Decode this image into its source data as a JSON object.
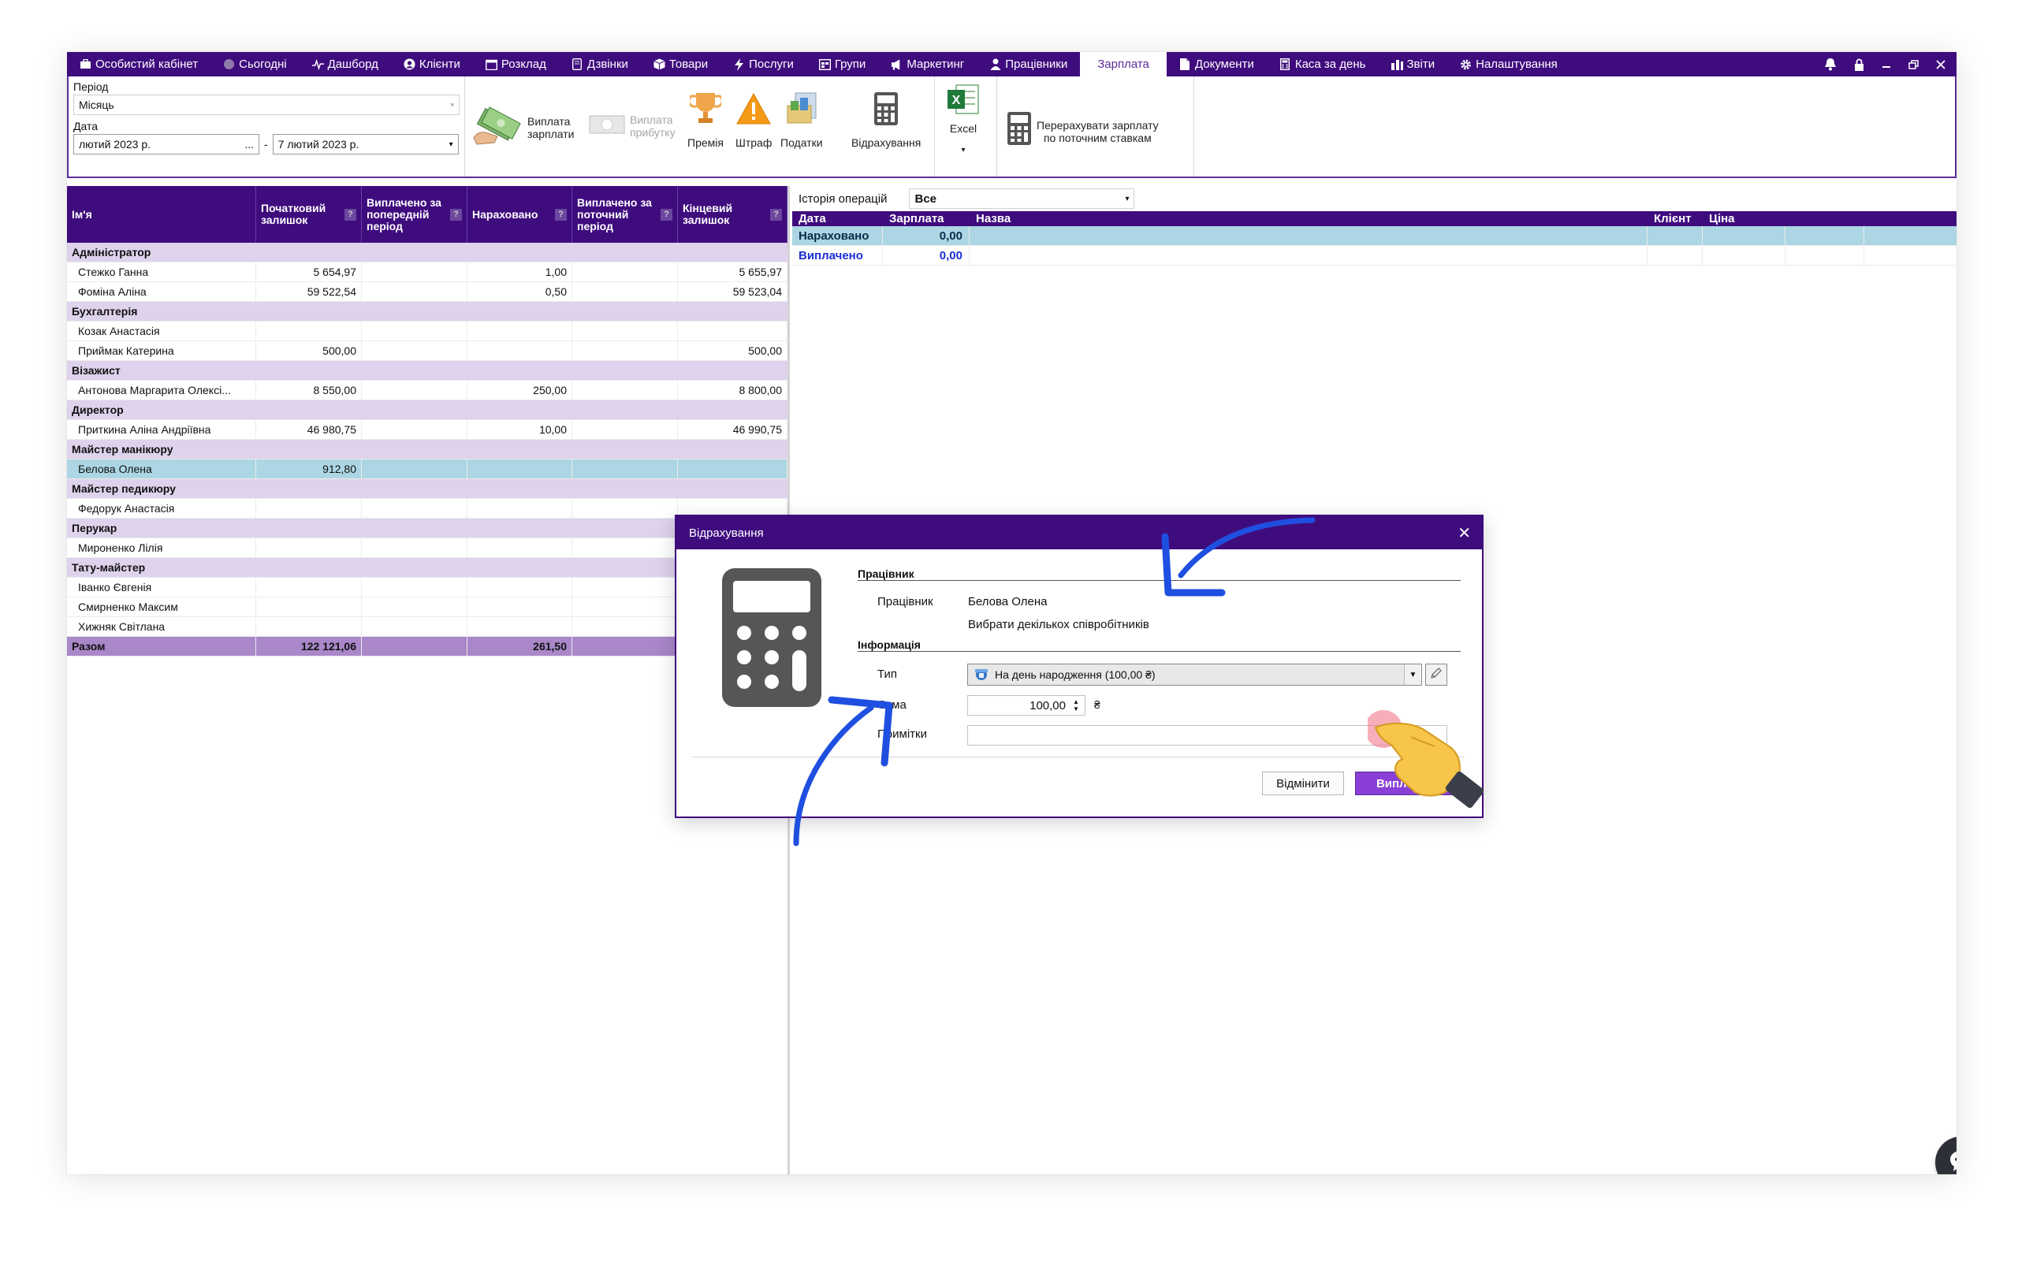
{
  "nav": {
    "items": [
      {
        "label": "Особистий кабінет",
        "icon": "cabinet-icon"
      },
      {
        "label": "Сьогодні",
        "icon": "today-icon"
      },
      {
        "label": "Дашборд",
        "icon": "dashboard-icon"
      },
      {
        "label": "Клієнти",
        "icon": "user-icon"
      },
      {
        "label": "Розклад",
        "icon": "calendar-icon"
      },
      {
        "label": "Дзвінки",
        "icon": "phone-icon"
      },
      {
        "label": "Товари",
        "icon": "box-icon"
      },
      {
        "label": "Послуги",
        "icon": "bolt-icon"
      },
      {
        "label": "Групи",
        "icon": "groups-icon"
      },
      {
        "label": "Маркетинг",
        "icon": "megaphone-icon"
      },
      {
        "label": "Працівники",
        "icon": "person-icon"
      },
      {
        "label": "Зарплата",
        "icon": ""
      },
      {
        "label": "Документи",
        "icon": "document-icon"
      },
      {
        "label": "Каса за день",
        "icon": "calculator-icon"
      },
      {
        "label": "Звіти",
        "icon": "bar-chart-icon"
      },
      {
        "label": "Налаштування",
        "icon": "gear-icon"
      }
    ],
    "active": "Зарплата"
  },
  "ribbon": {
    "period_label": "Період",
    "period_value": "Місяць",
    "date_label": "Дата",
    "date_from": "лютий 2023 р.",
    "date_from_btn": "...",
    "date_dash": "-",
    "date_to": "7 лютий 2023 р.",
    "pay_salary": "Виплата зарплати",
    "pay_profit": "Виплата прибутку",
    "bonus": "Премія",
    "fine": "Штраф",
    "taxes": "Податки",
    "deductions": "Відрахування",
    "excel": "Excel",
    "recalc_line1": "Перерахувати зарплату",
    "recalc_line2": "по поточним ставкам"
  },
  "grid": {
    "headers": [
      "Ім'я",
      "Початковий залишок",
      "Виплачено за попередній період",
      "Нараховано",
      "Виплачено за поточний період",
      "Кінцевий залишок"
    ],
    "help_mark": "?",
    "rows": [
      {
        "type": "group",
        "name": "Адміністратор"
      },
      {
        "type": "row",
        "name": "Стежко Ганна",
        "start": "5 654,97",
        "prev": "",
        "accr": "1,00",
        "cur": "",
        "end": "5 655,97"
      },
      {
        "type": "row",
        "name": "Фоміна Аліна",
        "start": "59 522,54",
        "prev": "",
        "accr": "0,50",
        "cur": "",
        "end": "59 523,04"
      },
      {
        "type": "group",
        "name": "Бухгалтерія"
      },
      {
        "type": "row",
        "name": "Козак Анастасія",
        "start": "",
        "prev": "",
        "accr": "",
        "cur": "",
        "end": ""
      },
      {
        "type": "row",
        "name": "Приймак Катерина",
        "start": "500,00",
        "prev": "",
        "accr": "",
        "cur": "",
        "end": "500,00"
      },
      {
        "type": "group",
        "name": "Візажист"
      },
      {
        "type": "row",
        "name": "Антонова Маргарита Олексі...",
        "start": "8 550,00",
        "prev": "",
        "accr": "250,00",
        "cur": "",
        "end": "8 800,00"
      },
      {
        "type": "group",
        "name": "Директор"
      },
      {
        "type": "row",
        "name": "Приткина Аліна Андріївна",
        "start": "46 980,75",
        "prev": "",
        "accr": "10,00",
        "cur": "",
        "end": "46 990,75"
      },
      {
        "type": "group",
        "name": "Майстер манікюру"
      },
      {
        "type": "sel",
        "name": "Белова Олена",
        "start": "912,80",
        "prev": "",
        "accr": "",
        "cur": "",
        "end": ""
      },
      {
        "type": "group",
        "name": "Майстер педикюру"
      },
      {
        "type": "row",
        "name": "Федорук Анастасія",
        "start": "",
        "prev": "",
        "accr": "",
        "cur": "",
        "end": ""
      },
      {
        "type": "group",
        "name": "Перукар"
      },
      {
        "type": "row",
        "name": "Мироненко Лілія",
        "start": "",
        "prev": "",
        "accr": "",
        "cur": "",
        "end": ""
      },
      {
        "type": "group",
        "name": "Тату-майстер"
      },
      {
        "type": "row",
        "name": "Іванко Євгенія",
        "start": "",
        "prev": "",
        "accr": "",
        "cur": "",
        "end": ""
      },
      {
        "type": "row",
        "name": "Смирненко Максим",
        "start": "",
        "prev": "",
        "accr": "",
        "cur": "",
        "end": ""
      },
      {
        "type": "row",
        "name": "Хижняк Світлана",
        "start": "",
        "prev": "",
        "accr": "",
        "cur": "",
        "end": ""
      },
      {
        "type": "total",
        "name": "Разом",
        "start": "122 121,06",
        "prev": "",
        "accr": "261,50",
        "cur": "",
        "end": ""
      }
    ]
  },
  "history": {
    "label": "Історія операцій",
    "filter": "Все",
    "headers": [
      "Дата",
      "Зарплата",
      "Назва",
      "Клієнт",
      "Ціна"
    ],
    "rows": [
      {
        "label": "Нараховано",
        "value": "0,00"
      },
      {
        "label": "Виплачено",
        "value": "0,00"
      }
    ]
  },
  "dialog": {
    "title": "Відрахування",
    "close": "✕",
    "section_employee": "Працівник",
    "employee_label": "Працівник",
    "employee_value": "Белова Олена",
    "select_multiple": "Вибрати декількох співробітників",
    "section_info": "Інформація",
    "type_label": "Тип",
    "type_value": "На день народження (100,00 ₴)",
    "sum_label": "Сума",
    "sum_value": "100,00",
    "currency": "₴",
    "notes_label": "Примітки",
    "notes_value": "",
    "cancel": "Відмінити",
    "pay": "Виплатити"
  },
  "colors": {
    "nav_bg": "#3f0c7e",
    "group_row": "#ded2ec",
    "selected_row": "#acd6e3",
    "total_row": "#a987c9",
    "pay_button": "#8a3fd6",
    "arrow": "#1f4fe0"
  }
}
